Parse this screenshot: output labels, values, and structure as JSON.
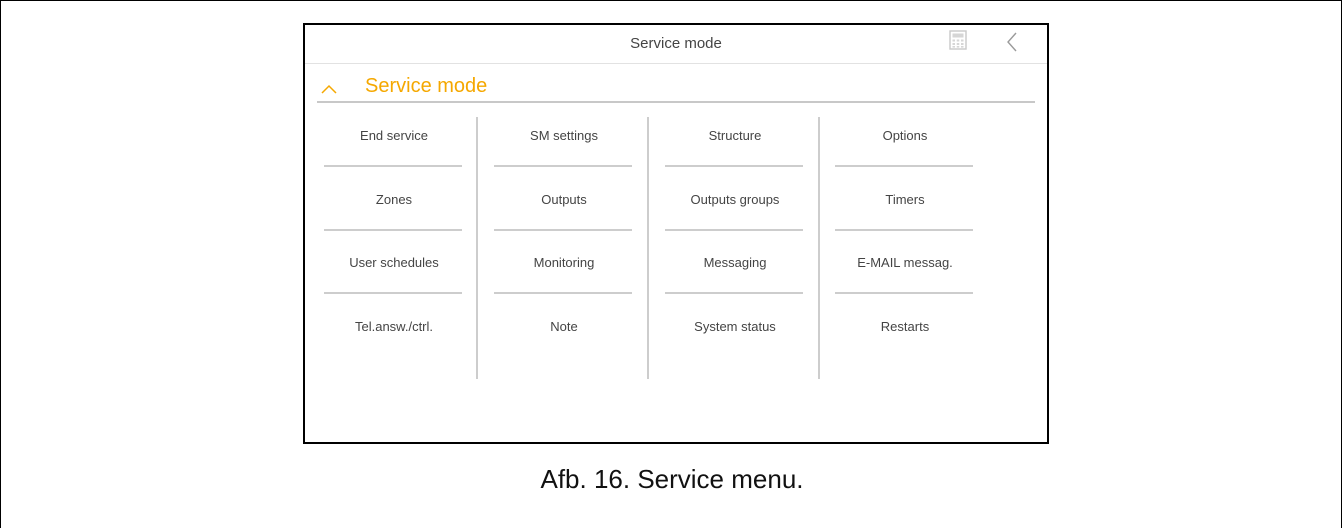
{
  "window": {
    "title": "Service mode"
  },
  "section": {
    "title": "Service mode"
  },
  "grid": {
    "rows": [
      [
        "End service",
        "SM settings",
        "Structure",
        "Options"
      ],
      [
        "Zones",
        "Outputs",
        "Outputs groups",
        "Timers"
      ],
      [
        "User schedules",
        "Monitoring",
        "Messaging",
        "E-MAIL messag."
      ],
      [
        "Tel.answ./ctrl.",
        "Note",
        "System status",
        "Restarts"
      ]
    ]
  },
  "caption": "Afb. 16. Service menu.",
  "icons": {
    "calculator": "calculator-icon",
    "back": "chevron-left-icon",
    "collapse": "chevron-up-icon"
  },
  "colors": {
    "accent": "#f5a800",
    "divider": "#cdcdcd"
  }
}
